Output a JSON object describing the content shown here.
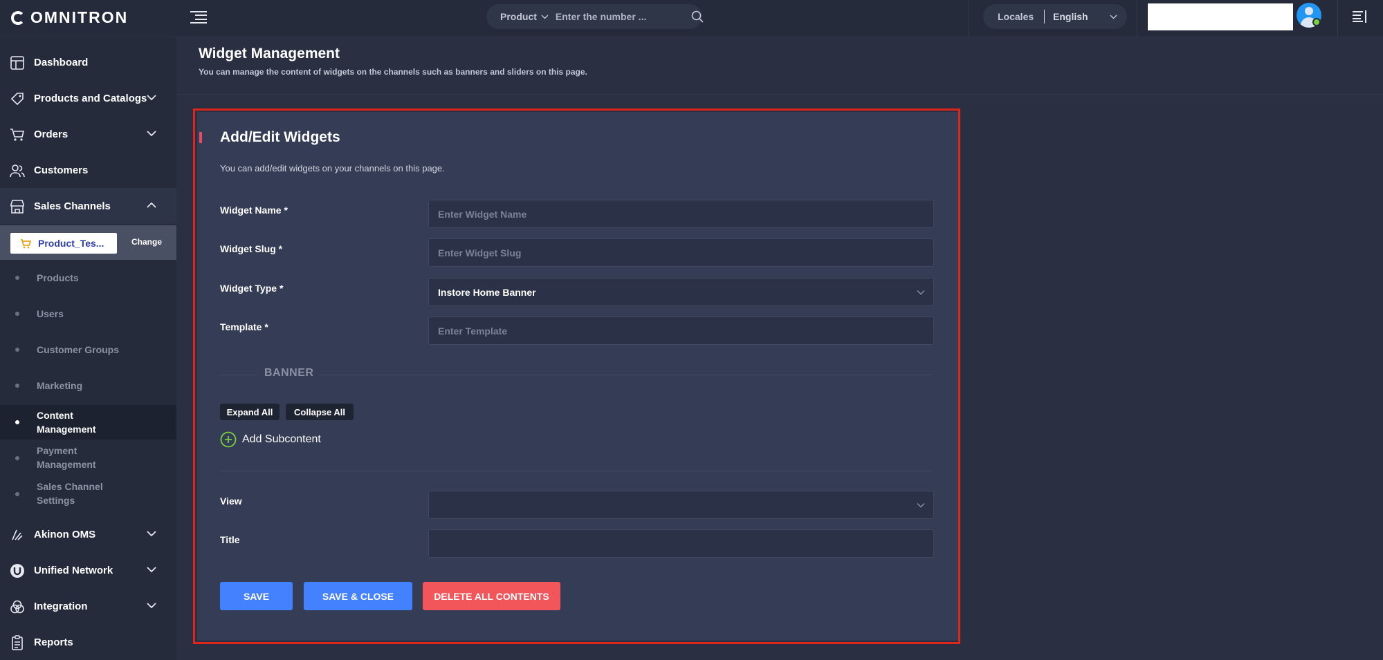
{
  "header": {
    "logo_text": "OMNITRON",
    "search": {
      "category": "Product",
      "placeholder": "Enter the number ..."
    },
    "locales_label": "Locales",
    "locale_value": "English"
  },
  "sidebar": {
    "items": [
      {
        "label": "Dashboard",
        "icon": "dashboard-icon"
      },
      {
        "label": "Products and Catalogs",
        "icon": "tag-icon"
      },
      {
        "label": "Orders",
        "icon": "cart-icon"
      },
      {
        "label": "Customers",
        "icon": "users-icon"
      },
      {
        "label": "Sales Channels",
        "icon": "store-icon"
      }
    ],
    "channel": {
      "name": "Product_Tes...",
      "change_label": "Change"
    },
    "sub_items": [
      {
        "label": "Products"
      },
      {
        "label": "Users"
      },
      {
        "label": "Customer Groups"
      },
      {
        "label": "Marketing"
      },
      {
        "label": "Content Management"
      },
      {
        "label": "Payment Management"
      },
      {
        "label": "Sales Channel Settings"
      }
    ],
    "bottom_items": [
      {
        "label": "Akinon OMS",
        "icon": "oms-icon"
      },
      {
        "label": "Unified Network",
        "icon": "network-icon"
      },
      {
        "label": "Integration",
        "icon": "integration-icon"
      },
      {
        "label": "Reports",
        "icon": "reports-icon"
      }
    ]
  },
  "page": {
    "title": "Widget Management",
    "description": "You can manage the content of widgets on the channels such as banners and sliders on this page."
  },
  "form": {
    "title": "Add/Edit Widgets",
    "description": "You can add/edit widgets on your channels on this page.",
    "fields": {
      "widget_name": {
        "label": "Widget Name *",
        "placeholder": "Enter Widget Name",
        "value": ""
      },
      "widget_slug": {
        "label": "Widget Slug *",
        "placeholder": "Enter Widget Slug",
        "value": ""
      },
      "widget_type": {
        "label": "Widget Type *",
        "value": "Instore Home Banner"
      },
      "template": {
        "label": "Template *",
        "placeholder": "Enter Template",
        "value": ""
      },
      "view": {
        "label": "View",
        "value": ""
      },
      "title": {
        "label": "Title",
        "value": ""
      }
    },
    "banner_label": "BANNER",
    "expand_all": "Expand All",
    "collapse_all": "Collapse All",
    "add_subcontent": "Add Subcontent",
    "buttons": {
      "save": "SAVE",
      "save_close": "SAVE & CLOSE",
      "delete_all": "DELETE ALL CONTENTS"
    }
  },
  "colors": {
    "primary": "#4481ff",
    "danger": "#f2555a",
    "highlight_outline": "#e0261b",
    "add_icon": "#7bd13b"
  }
}
